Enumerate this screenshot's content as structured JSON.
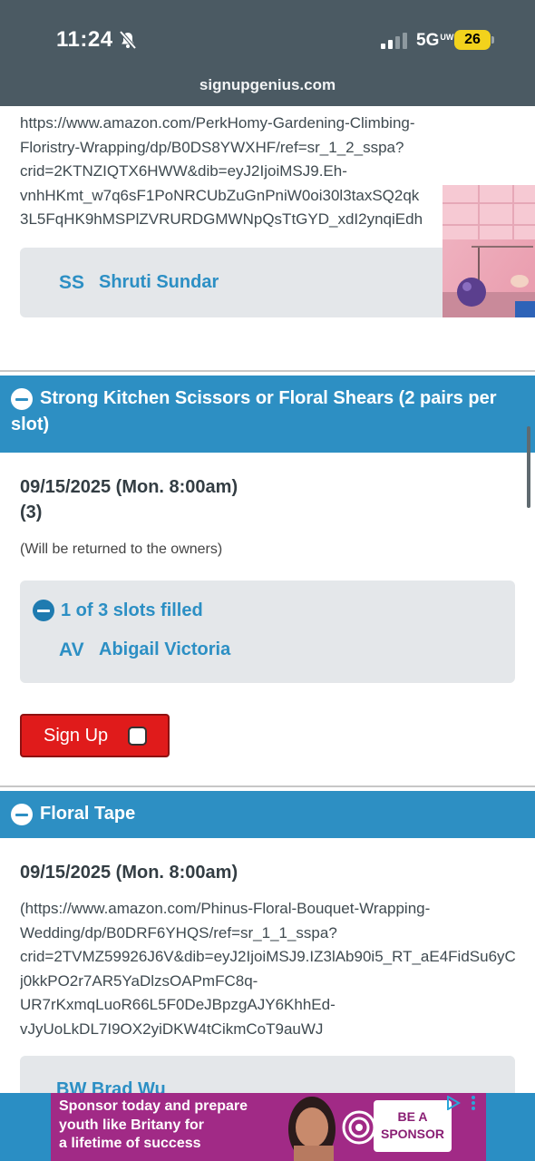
{
  "status_bar": {
    "time": "11:24",
    "network": "5G",
    "network_sub": "UW",
    "battery": "26"
  },
  "browser": {
    "domain": "signupgenius.com"
  },
  "previous_item": {
    "url_lines": [
      "https://www.amazon.com/PerkHomy-Gardening-Climbing-",
      "Floristry-Wrapping/dp/B0DS8YWXHF/ref=sr_1_2_sspa?",
      "crid=2KTNZIQTX6HWW&dib=eyJ2IjoiMSJ9.Eh-",
      "vnhHKmt_w7q6sF1PoNRCUbZuGnPniW0oi30l3taxSQ2qk",
      "3L5FqHK9hMSPlZVRURDGMWNpQsTtGYD_xdI2ynqiEdh"
    ],
    "signer": {
      "initials": "SS",
      "name": "Shruti Sundar"
    }
  },
  "sections": [
    {
      "title_line1": "Strong Kitchen Scissors or Floral Shears (2 pairs per",
      "title_line2": "slot)",
      "date": "09/15/2025 (Mon. 8:00am)",
      "quantity": "(3)",
      "note": "(Will be returned to the owners)",
      "filled_label": "1 of 3 slots filled",
      "signer": {
        "initials": "AV",
        "name": "Abigail Victoria"
      },
      "signup_label": "Sign Up"
    },
    {
      "title": "Floral Tape",
      "date": "09/15/2025 (Mon. 8:00am)",
      "url_lines": [
        "(https://www.amazon.com/Phinus-Floral-Bouquet-Wrapping-",
        "Wedding/dp/B0DRF6YHQS/ref=sr_1_1_sspa?",
        "crid=2TVMZ59926J6V&dib=eyJ2IjoiMSJ9.IZ3lAb90i5_RT_aE4FidSu6yC",
        "j0kkPO2r7AR5YaDlzsOAPmFC8q-",
        "UR7rKxmqLuoR66L5F0DeJBpzgAJY6KhhEd-",
        "vJyUoLkDL7I9OX2yiDKW4tCikmCoT9auWJ"
      ],
      "signer_partial": "BW  Brad Wu"
    }
  ],
  "ad": {
    "text_line1": "Sponsor today and prepare",
    "text_line2": "youth like Britany for",
    "text_line3": "a lifetime of success",
    "cta_line1": "BE A",
    "cta_line2": "SPONSOR"
  },
  "colors": {
    "header_bg": "#4b5a63",
    "section_blue": "#2d8fc3",
    "link_blue": "#2c8fc4",
    "signup_red": "#e01b1b",
    "ad_purple": "#a12a86",
    "battery_yellow": "#f2d21c"
  }
}
